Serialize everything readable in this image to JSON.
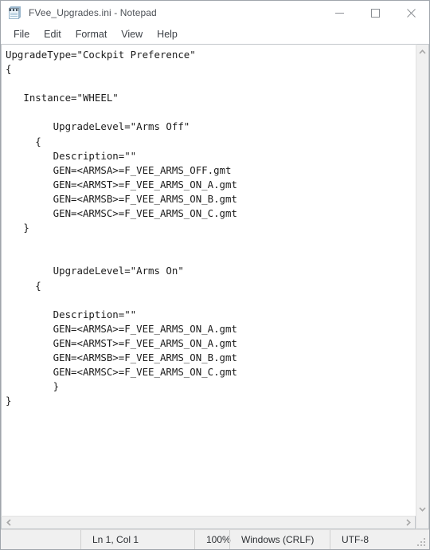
{
  "window": {
    "title": "FVee_Upgrades.ini - Notepad",
    "app_icon": "notepad-icon",
    "controls": {
      "minimize": "minimize-button",
      "maximize": "maximize-button",
      "close": "close-button"
    }
  },
  "menubar": {
    "items": [
      {
        "label": "File"
      },
      {
        "label": "Edit"
      },
      {
        "label": "Format"
      },
      {
        "label": "View"
      },
      {
        "label": "Help"
      }
    ]
  },
  "editor": {
    "content": "UpgradeType=\"Cockpit Preference\"\n{\n\n   Instance=\"WHEEL\"\n\n        UpgradeLevel=\"Arms Off\"\n     {\n        Description=\"\"\n        GEN=<ARMSA>=F_VEE_ARMS_OFF.gmt\n        GEN=<ARMST>=F_VEE_ARMS_ON_A.gmt\n        GEN=<ARMSB>=F_VEE_ARMS_ON_B.gmt\n        GEN=<ARMSC>=F_VEE_ARMS_ON_C.gmt\n   }\n\n\n        UpgradeLevel=\"Arms On\"\n     {\n\n        Description=\"\"\n        GEN=<ARMSA>=F_VEE_ARMS_ON_A.gmt\n        GEN=<ARMST>=F_VEE_ARMS_ON_A.gmt\n        GEN=<ARMSB>=F_VEE_ARMS_ON_B.gmt\n        GEN=<ARMSC>=F_VEE_ARMS_ON_C.gmt\n        }\n}",
    "scrollbars": {
      "vertical_up": "scroll-up-arrow",
      "vertical_down": "scroll-down-arrow",
      "horizontal_left": "scroll-left-arrow",
      "horizontal_right": "scroll-right-arrow"
    }
  },
  "statusbar": {
    "line_col": "Ln 1, Col 1",
    "zoom": "100%",
    "line_ending": "Windows (CRLF)",
    "encoding": "UTF-8"
  },
  "colors": {
    "window_bg": "#f0f0f0",
    "titlebar_bg": "#ffffff",
    "text_bg": "#ffffff",
    "text_fg": "#1b1b1b",
    "border": "#9fa5ab",
    "close_hover": "#e81123"
  }
}
